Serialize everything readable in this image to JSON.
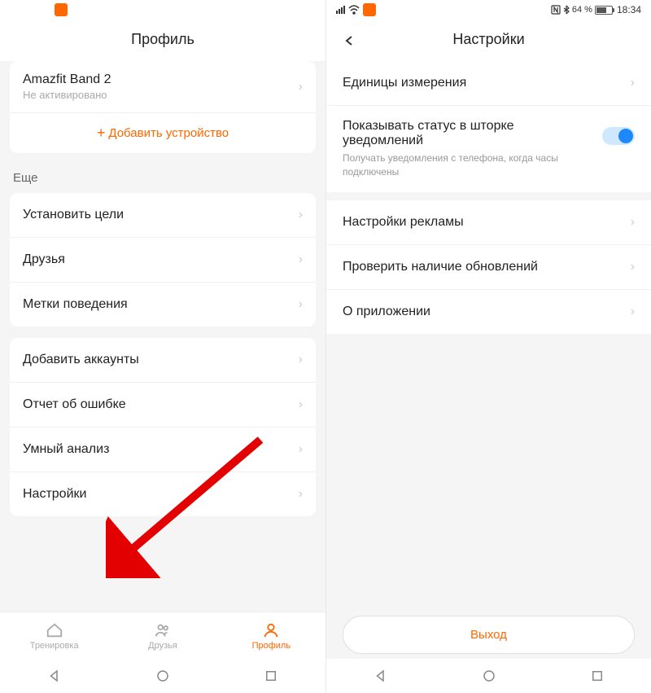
{
  "left": {
    "title": "Профиль",
    "device": {
      "name": "Amazfit Band 2",
      "status": "Не активировано"
    },
    "add_device": "Добавить устройство",
    "section_header": "Еще",
    "group1": [
      {
        "label": "Установить цели"
      },
      {
        "label": "Друзья"
      },
      {
        "label": "Метки поведения"
      }
    ],
    "group2": [
      {
        "label": "Добавить аккаунты"
      },
      {
        "label": "Отчет об ошибке"
      },
      {
        "label": "Умный анализ"
      },
      {
        "label": "Настройки"
      }
    ],
    "nav": [
      {
        "label": "Тренировка"
      },
      {
        "label": "Друзья"
      },
      {
        "label": "Профиль"
      }
    ]
  },
  "right": {
    "status": {
      "battery_text": "64 %",
      "time": "18:34"
    },
    "title": "Настройки",
    "group1": [
      {
        "label": "Единицы измерения"
      }
    ],
    "notification": {
      "label": "Показывать статус в шторке уведомлений",
      "sublabel": "Получать уведомления с телефона, когда часы подключены"
    },
    "group2": [
      {
        "label": "Настройки рекламы"
      },
      {
        "label": "Проверить наличие обновлений"
      },
      {
        "label": "О приложении"
      }
    ],
    "exit": "Выход"
  }
}
